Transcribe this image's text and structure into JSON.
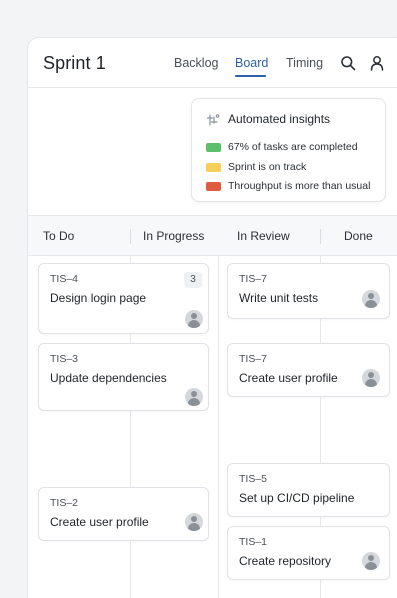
{
  "header": {
    "title": "Sprint 1",
    "nav": [
      "Backlog",
      "Board",
      "Timing"
    ],
    "active_tab": "Board",
    "icons": [
      "search-icon",
      "user-icon"
    ]
  },
  "insights": {
    "title": "Automated insights",
    "icon": "insights-icon",
    "items": [
      {
        "text": "67% of tasks are completed",
        "color": "#5cbf6a"
      },
      {
        "text": "Sprint is on track",
        "color": "#f6cf5a"
      },
      {
        "text": "Throughput is more than usual",
        "color": "#e05a3f"
      }
    ]
  },
  "columns": [
    "To Do",
    "In Progress",
    "In Review",
    "Done"
  ],
  "cards": [
    {
      "key": "TIS–4",
      "title": "Design login page",
      "badge": "3"
    },
    {
      "key": "TIS–3",
      "title": "Update dependencies"
    },
    {
      "key": "TIS–2",
      "title": "Create user profile"
    },
    {
      "key": "TIS–7",
      "title": "Write unit tests"
    },
    {
      "key": "TIS–7",
      "title": "Create user profile"
    },
    {
      "key": "TIS–5",
      "title": "Set up CI/CD pipeline"
    },
    {
      "key": "TIS–1",
      "title": "Create repository"
    }
  ],
  "colors": {
    "accent": "#2f5ea8",
    "border": "#dfe2e6",
    "background": "#f3f4f6"
  }
}
